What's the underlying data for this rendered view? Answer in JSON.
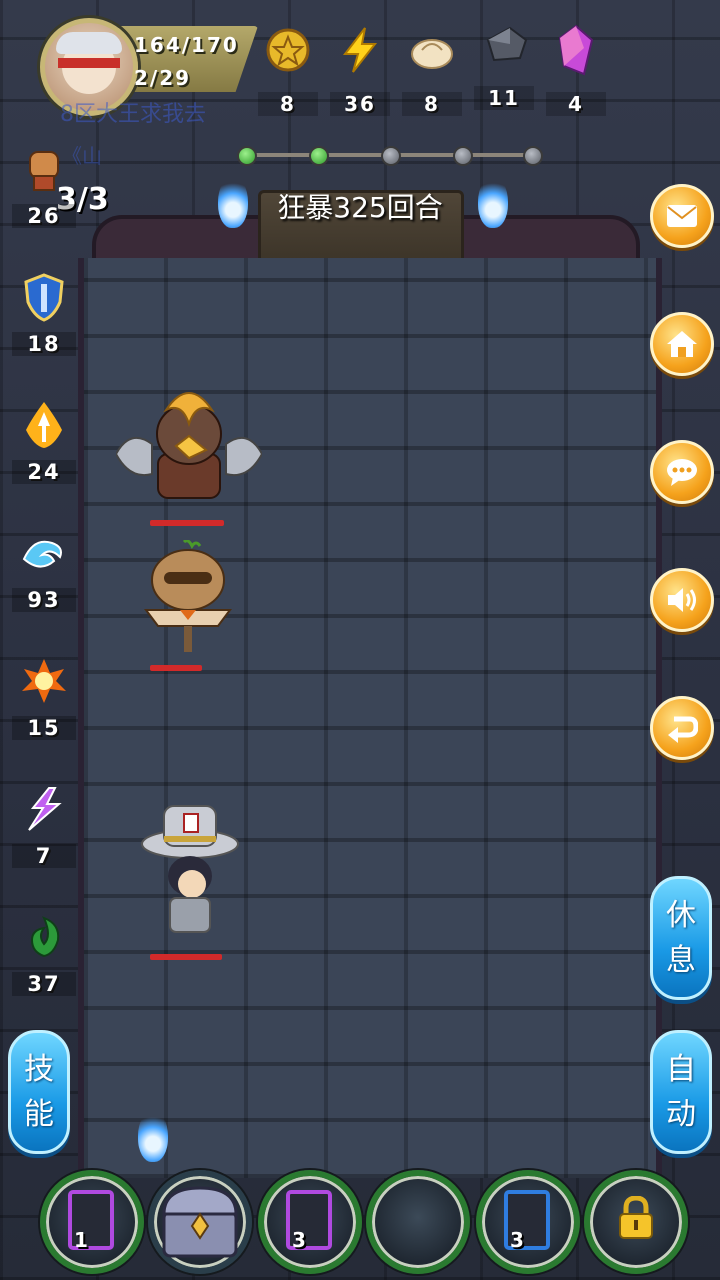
{
  "player": {
    "hp": "164/170",
    "stamina": "2/29",
    "quest_text": "8区大王求我去",
    "quest_text2": "《山"
  },
  "resources": [
    {
      "icon": "gold-coin-icon",
      "value": "8"
    },
    {
      "icon": "lightning-energy-icon",
      "value": "36"
    },
    {
      "icon": "steamed-bun-icon",
      "value": "8"
    },
    {
      "icon": "iron-ore-icon",
      "value": "11"
    },
    {
      "icon": "crystal-gem-icon",
      "value": "4"
    }
  ],
  "battle": {
    "wave": "3/3",
    "round_text": "狂暴325回合",
    "progress_total": 5,
    "progress_done": 2
  },
  "skills": [
    {
      "icon": "fist-icon",
      "value": "26"
    },
    {
      "icon": "shield-icon",
      "value": "18"
    },
    {
      "icon": "holy-sword-icon",
      "value": "24"
    },
    {
      "icon": "water-wave-icon",
      "value": "93"
    },
    {
      "icon": "fire-burst-icon",
      "value": "15"
    },
    {
      "icon": "purple-lightning-icon",
      "value": "7"
    },
    {
      "icon": "green-poison-icon",
      "value": "37"
    }
  ],
  "right_menu": [
    "mail-icon",
    "home-icon",
    "chat-icon",
    "sound-icon",
    "return-icon"
  ],
  "buttons": {
    "rest": "休息",
    "auto": "自动",
    "skill": "技能"
  },
  "characters": [
    {
      "name": "axe-warrior-enemy",
      "hp_fraction": 1.0
    },
    {
      "name": "scarecrow-dummy-enemy",
      "hp_fraction": 1.0
    },
    {
      "name": "gambler-hero",
      "hp_fraction": 1.0
    }
  ],
  "bottom_slots": [
    {
      "type": "card",
      "color": "purple",
      "count": "1"
    },
    {
      "type": "chest",
      "count": ""
    },
    {
      "type": "card",
      "color": "purple",
      "count": "3"
    },
    {
      "type": "empty",
      "count": ""
    },
    {
      "type": "card",
      "color": "blue",
      "count": "3"
    },
    {
      "type": "locked",
      "count": ""
    }
  ]
}
